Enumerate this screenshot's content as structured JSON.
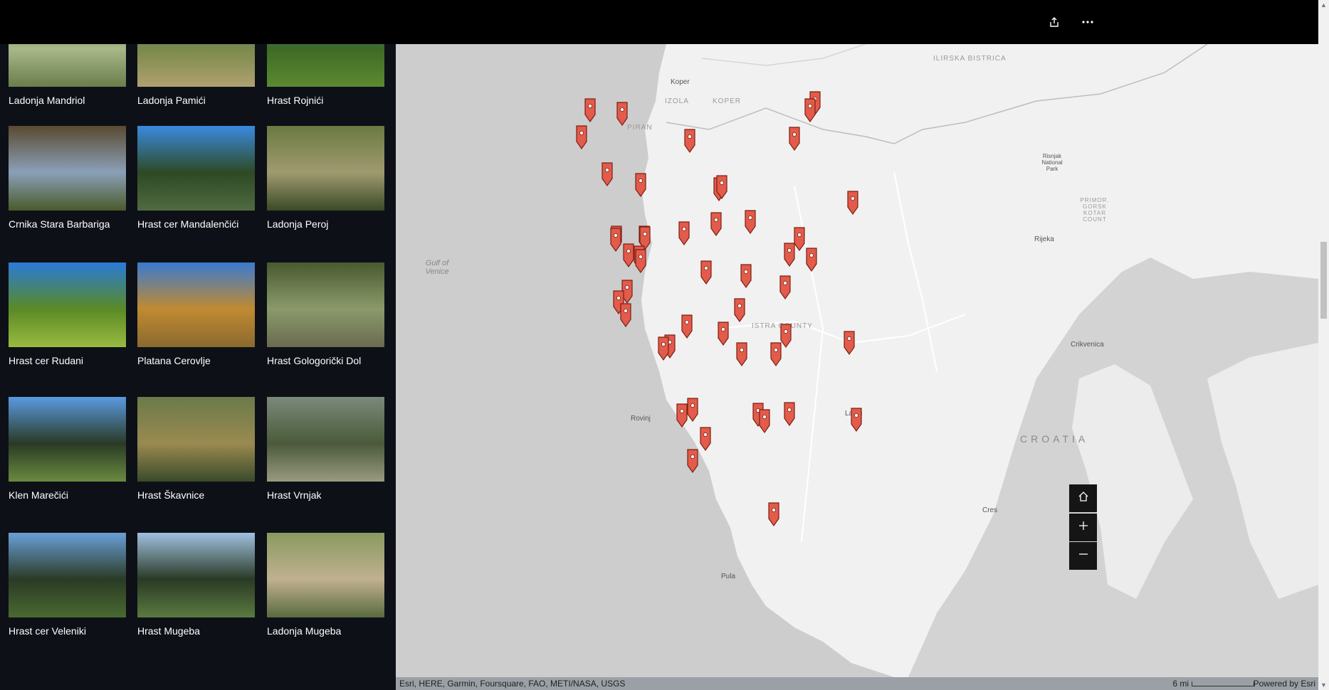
{
  "toolbar": {
    "share_icon": "share-icon",
    "more_icon": "more-options-icon"
  },
  "gallery": {
    "items": [
      {
        "label": "Ladonja Mandriol",
        "colors": [
          "#3d5a2a",
          "#a8b88a",
          "#6b7d4b"
        ]
      },
      {
        "label": "Ladonja Pamići",
        "colors": [
          "#2a6bd1",
          "#7a8a4a",
          "#b0a070"
        ]
      },
      {
        "label": "Hrast Rojnići",
        "colors": [
          "#2b7fd8",
          "#3f6a25",
          "#5b8a30"
        ]
      },
      {
        "label": "Crnika Stara Barbariga",
        "colors": [
          "#5a4a30",
          "#8aa0b8",
          "#4a5a2a"
        ]
      },
      {
        "label": "Hrast cer Mandalenčići",
        "colors": [
          "#3a8ae0",
          "#2d4a25",
          "#506a40"
        ]
      },
      {
        "label": "Ladonja Peroj",
        "colors": [
          "#6a7a40",
          "#a09a70",
          "#3a4a25"
        ]
      },
      {
        "label": "Hrast cer Rudani",
        "colors": [
          "#2a7ad8",
          "#5a8a25",
          "#9aba40"
        ]
      },
      {
        "label": "Platana Cerovlje",
        "colors": [
          "#3a7ad0",
          "#c08a30",
          "#8a6a30"
        ]
      },
      {
        "label": "Hrast Gologorički Dol",
        "colors": [
          "#4a5a30",
          "#8a9a6a",
          "#6a6a50"
        ]
      },
      {
        "label": "Klen Marečići",
        "colors": [
          "#5a9ae0",
          "#2a3a25",
          "#6a8a40"
        ]
      },
      {
        "label": "Hrast Škavnice",
        "colors": [
          "#6a7a4a",
          "#9a8a50",
          "#3a4a2a"
        ]
      },
      {
        "label": "Hrast Vrnjak",
        "colors": [
          "#7a8a7a",
          "#4a5a3a",
          "#9a9a80"
        ]
      },
      {
        "label": "Hrast cer Veleniki",
        "colors": [
          "#6aa0d8",
          "#2a3a25",
          "#4a6a30"
        ]
      },
      {
        "label": "Hrast Mugeba",
        "colors": [
          "#a0c0e0",
          "#2a3a25",
          "#5a7a40"
        ]
      },
      {
        "label": "Ladonja Mugeba",
        "colors": [
          "#8a9a60",
          "#c0b090",
          "#5a6a40"
        ]
      }
    ]
  },
  "map": {
    "labels": [
      {
        "text": "Koper",
        "cls": ""
      },
      {
        "text": "IZOLA",
        "cls": "region"
      },
      {
        "text": "KOPER",
        "cls": "region"
      },
      {
        "text": "PIRAN",
        "cls": "region"
      },
      {
        "text": "ILIRSKA BISTRICA",
        "cls": "region"
      },
      {
        "text": "Risnjak National Park",
        "cls": ""
      },
      {
        "text": "PRIMOR. GORSK KOTAR COUNT",
        "cls": "region"
      },
      {
        "text": "Rijeka",
        "cls": ""
      },
      {
        "text": "Gulf of Venice",
        "cls": "water"
      },
      {
        "text": "ISTRA COUNTY",
        "cls": "region"
      },
      {
        "text": "Crikvenica",
        "cls": ""
      },
      {
        "text": "Rovinj",
        "cls": ""
      },
      {
        "text": "Labin",
        "cls": ""
      },
      {
        "text": "CROATIA",
        "cls": "country"
      },
      {
        "text": "Cres",
        "cls": ""
      },
      {
        "text": "Pula",
        "cls": ""
      }
    ],
    "marker_count": 49,
    "marker_color": "#e35b4a",
    "attribution": "Esri, HERE, Garmin, Foursquare, FAO, METI/NASA, USGS",
    "scale_label": "6 mi",
    "powered_by": "Powered by Esri",
    "buttons": {
      "home_icon": "home-icon",
      "zoom_in_icon": "zoom-in-icon",
      "zoom_out_icon": "zoom-out-icon"
    }
  }
}
